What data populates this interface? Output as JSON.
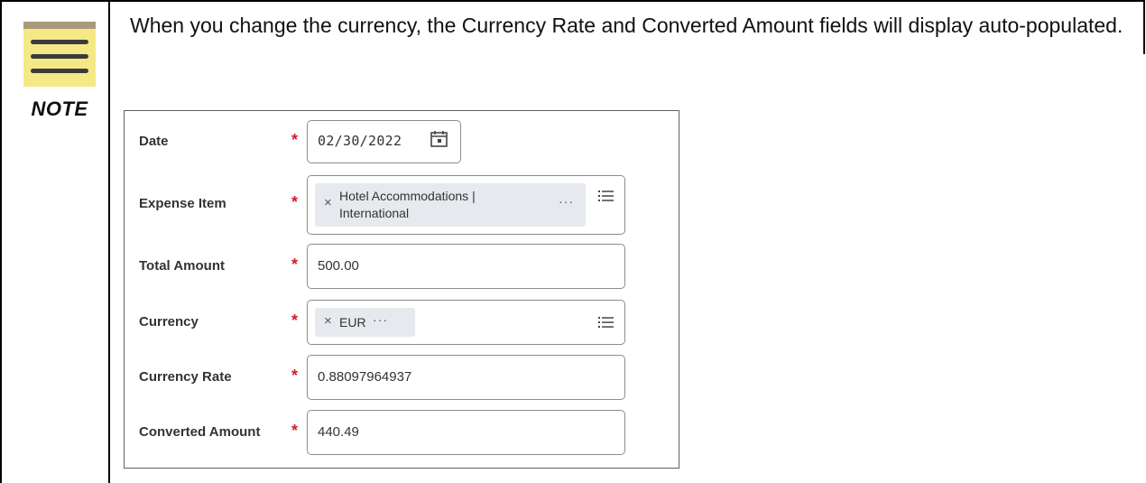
{
  "note": {
    "icon_label": "NOTE",
    "text": "When you change the currency, the Currency Rate and Converted Amount fields will display auto-populated."
  },
  "colors": {
    "required_star": "#d0202a",
    "note_paper": "#f4e985",
    "pill_bg": "#e6e9ed"
  },
  "form": {
    "required_mark": "*",
    "date": {
      "label": "Date",
      "value": "02/30/2022",
      "icon": "calendar-icon"
    },
    "expense_item": {
      "label": "Expense Item",
      "value_line1": "Hotel Accommodations |",
      "value_line2": "International",
      "remove": "×",
      "more": "···",
      "icon": "list-icon"
    },
    "total_amount": {
      "label": "Total Amount",
      "value": "500.00"
    },
    "currency": {
      "label": "Currency",
      "value": "EUR",
      "remove": "×",
      "more": "···",
      "icon": "list-icon"
    },
    "currency_rate": {
      "label": "Currency Rate",
      "value": "0.88097964937"
    },
    "converted_amount": {
      "label": "Converted Amount",
      "value": "440.49"
    }
  }
}
